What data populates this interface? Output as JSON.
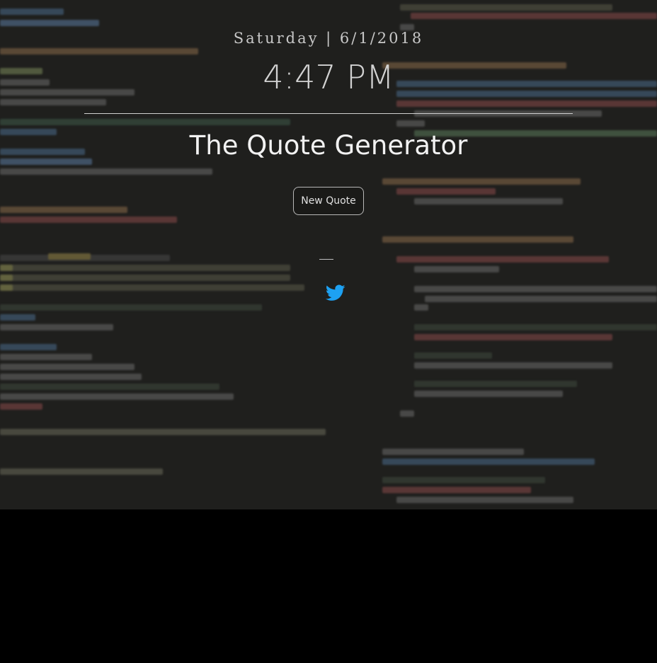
{
  "header": {
    "date": "Saturday | 6/1/2018",
    "time": "4:47 PM"
  },
  "main": {
    "title": "The Quote Generator",
    "new_quote_label": "New Quote",
    "quote_separator": "—"
  },
  "icons": {
    "share": "twitter-icon"
  },
  "colors": {
    "page_background": "#000000",
    "hero_background": "#1f1f1d",
    "twitter_blue": "#1da1f2",
    "text_primary": "#f2f2f2",
    "text_secondary": "#c8c8c8"
  }
}
